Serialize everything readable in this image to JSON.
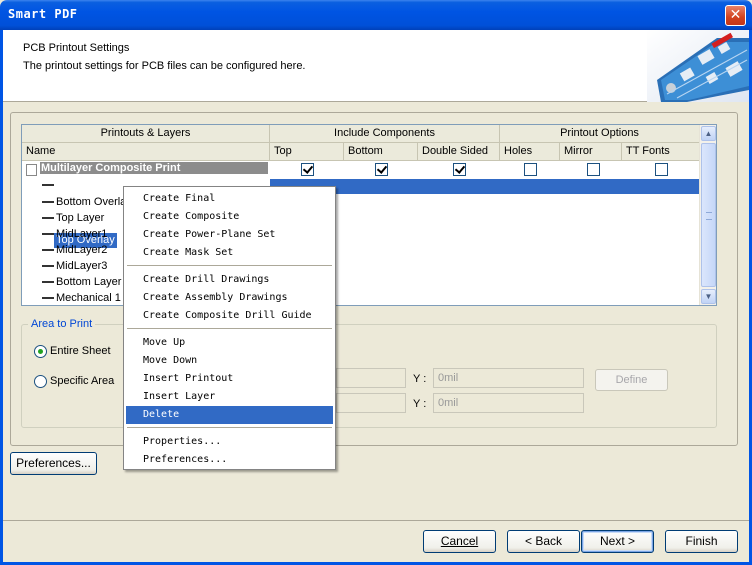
{
  "window": {
    "title": "Smart PDF",
    "close_icon": "close-icon"
  },
  "header": {
    "title": "PCB Printout Settings",
    "subtitle": "The printout settings for PCB files can be configured here."
  },
  "grid": {
    "groups": {
      "printouts_layers": "Printouts & Layers",
      "include_components": "Include Components",
      "printout_options": "Printout Options"
    },
    "columns": [
      "Name",
      "Top",
      "Bottom",
      "Double Sided",
      "Holes",
      "Mirror",
      "TT Fonts"
    ],
    "printout": {
      "name": "Multilayer Composite Print",
      "top": true,
      "bottom": true,
      "double_sided": true,
      "holes": false,
      "mirror": false,
      "tt_fonts": false
    },
    "layers": [
      "Top Overlay",
      "Bottom Overlay",
      "Top Layer",
      "MidLayer1",
      "MidLayer2",
      "MidLayer3",
      "Bottom Layer",
      "Mechanical 1"
    ],
    "selected_layer": "Top Overlay"
  },
  "area": {
    "title": "Area to Print",
    "entire_sheet": "Entire Sheet",
    "specific_area": "Specific Area",
    "selected": "Entire Sheet",
    "y_label": "Y :",
    "y1_value": "0mil",
    "y2_value": "0mil",
    "define_label": "Define"
  },
  "context_menu": {
    "items": [
      "Create Final",
      "Create Composite",
      "Create Power-Plane Set",
      "Create Mask Set",
      "Create Drill Drawings",
      "Create Assembly Drawings",
      "Create Composite Drill Guide",
      "Move Up",
      "Move Down",
      "Insert Printout",
      "Insert Layer",
      "Delete",
      "Properties...",
      "Preferences..."
    ],
    "highlighted": "Delete"
  },
  "buttons": {
    "preferences": "Preferences...",
    "cancel": "Cancel",
    "back": "< Back",
    "next": "Next >",
    "finish": "Finish"
  },
  "colors": {
    "titlebar": "#0054e3",
    "selection": "#316ac5",
    "dialog_bg": "#ece9d8"
  }
}
